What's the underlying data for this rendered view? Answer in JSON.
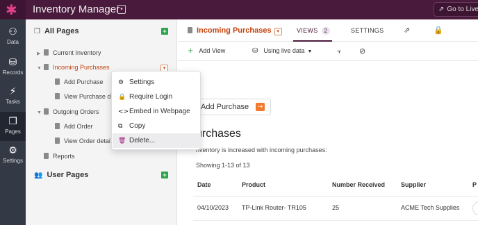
{
  "topbar": {
    "logo_glyph": "✱",
    "app_title": "Inventory Manager",
    "app_dropdown_glyph": "▾",
    "goto_live": "Go to Live"
  },
  "rail": [
    {
      "label": "Data",
      "icon": "data-icon",
      "glyph": "⚇"
    },
    {
      "label": "Records",
      "icon": "records-icon",
      "glyph": "⛁"
    },
    {
      "label": "Tasks",
      "icon": "tasks-icon",
      "glyph": "⚡"
    },
    {
      "label": "Pages",
      "icon": "pages-icon",
      "glyph": "❐"
    },
    {
      "label": "Settings",
      "icon": "settings-icon",
      "glyph": "⚙"
    }
  ],
  "sidebar": {
    "all_pages_title": "All Pages",
    "user_pages_title": "User Pages",
    "add_glyph": "+",
    "items": [
      {
        "label": "Current Inventory"
      },
      {
        "label": "Incoming Purchases"
      },
      {
        "label": "Add Purchase"
      },
      {
        "label": "View Purchase d"
      },
      {
        "label": "Outgoing Orders"
      },
      {
        "label": "Add Order"
      },
      {
        "label": "View Order detai"
      },
      {
        "label": "Reports"
      }
    ]
  },
  "context_menu": {
    "items": [
      {
        "label": "Settings",
        "glyph": "⚙"
      },
      {
        "label": "Require Login",
        "glyph": "🔒"
      },
      {
        "label": "Embed in Webpage",
        "glyph": "<>"
      },
      {
        "label": "Copy",
        "glyph": "⧉"
      },
      {
        "label": "Delete...",
        "glyph": "🗑"
      }
    ]
  },
  "main": {
    "page_title": "Incoming Purchases",
    "tabs": {
      "views": "VIEWS",
      "views_count": "2",
      "settings": "SETTINGS"
    },
    "toolbar": {
      "add_view": "Add View",
      "live_data": "Using live data"
    },
    "add_purchase_button": "Add Purchase",
    "view_title": "urchases",
    "view_description": "nventory is increased with incoming purchases:",
    "showing": "Showing 1-13 of 13",
    "table": {
      "columns": [
        "Date",
        "Product",
        "Number Received",
        "Supplier",
        "P"
      ],
      "rows": [
        [
          "04/10/2023",
          "TP-Link Router- TR105",
          "25",
          "ACME Tech Supplies"
        ]
      ]
    }
  },
  "colors": {
    "topbar": "#4a1a3c",
    "rail": "#343a45",
    "accent_orange": "#c2410c",
    "add_green": "#2ea44f",
    "delete_purple": "#a0207a"
  }
}
